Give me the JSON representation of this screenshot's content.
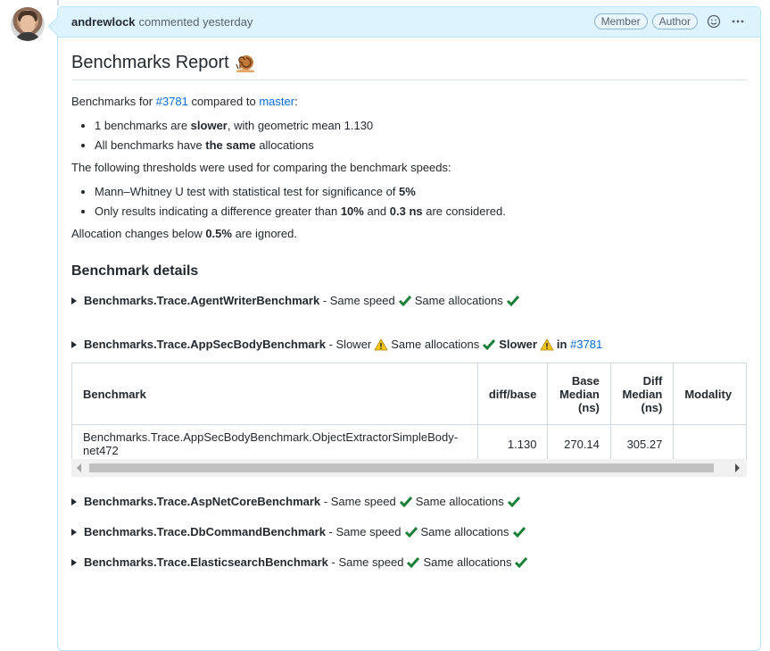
{
  "comment": {
    "author": "andrewlock",
    "meta": "commented yesterday",
    "badges": [
      "Member",
      "Author"
    ]
  },
  "report": {
    "title": "Benchmarks Report",
    "intro_prefix": "Benchmarks for",
    "pr_link": "#3781",
    "intro_mid": "compared to",
    "base_link": "master",
    "intro_suffix": ":",
    "summary": [
      {
        "pre": "1 benchmarks are ",
        "bold": "slower",
        "post": ", with geometric mean 1.130"
      },
      {
        "pre": "All benchmarks have ",
        "bold": "the same",
        "post": " allocations"
      }
    ],
    "thresholds_intro": "The following thresholds were used for comparing the benchmark speeds:",
    "thresholds": [
      {
        "pre": "Mann–Whitney U test with statistical test for significance of ",
        "b1": "5%",
        "mid": "",
        "b2": "",
        "post": ""
      },
      {
        "pre": "Only results indicating a difference greater than ",
        "b1": "10%",
        "mid": " and ",
        "b2": "0.3 ns",
        "post": " are considered."
      }
    ],
    "alloc_pre": "Allocation changes below ",
    "alloc_bold": "0.5%",
    "alloc_post": " are ignored.",
    "details_heading": "Benchmark details"
  },
  "benchmarks": [
    {
      "name": "Benchmarks.Trace.AgentWriterBenchmark",
      "speed": "Same speed",
      "alloc": "Same allocations"
    },
    {
      "name": "Benchmarks.Trace.AppSecBodyBenchmark",
      "speed": "Slower",
      "alloc": "Same allocations",
      "extra_bold": "Slower",
      "extra_in": "in",
      "extra_link": "#3781"
    },
    {
      "name": "Benchmarks.Trace.AspNetCoreBenchmark",
      "speed": "Same speed",
      "alloc": "Same allocations"
    },
    {
      "name": "Benchmarks.Trace.DbCommandBenchmark",
      "speed": "Same speed",
      "alloc": "Same allocations"
    },
    {
      "name": "Benchmarks.Trace.ElasticsearchBenchmark",
      "speed": "Same speed",
      "alloc": "Same allocations"
    }
  ],
  "table": {
    "headers": [
      "Benchmark",
      "diff/base",
      "Base Median (ns)",
      "Diff Median (ns)",
      "Modality"
    ],
    "rows": [
      [
        "Benchmarks.Trace.AppSecBodyBenchmark.ObjectExtractorSimpleBody-net472",
        "1.130",
        "270.14",
        "305.27",
        ""
      ]
    ]
  },
  "icons": {
    "check_color": "#1a7f37",
    "warn_color": "#f5c518"
  }
}
